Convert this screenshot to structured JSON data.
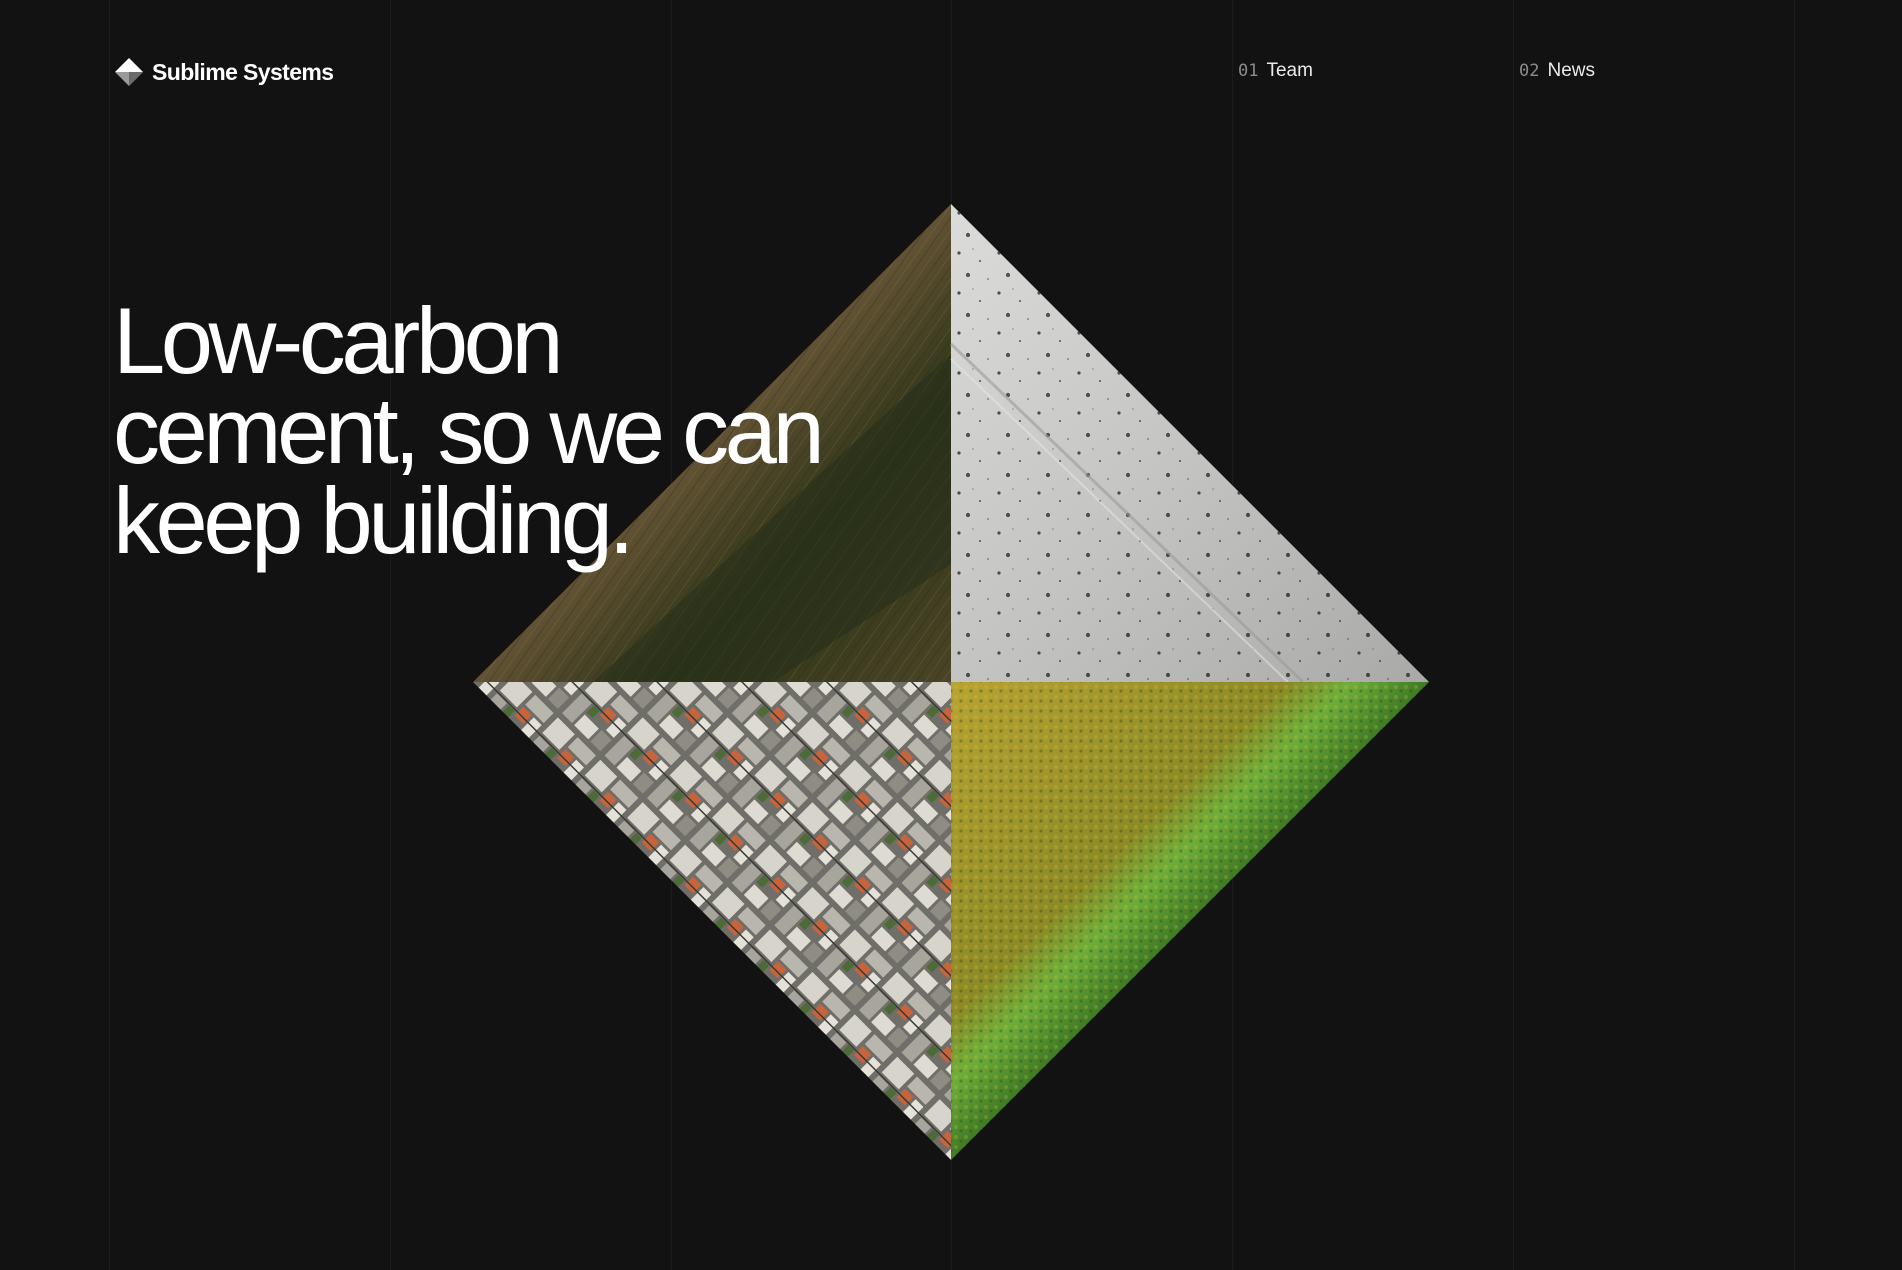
{
  "brand": {
    "name": "Sublime Systems",
    "logo_icon": "diamond-logo-icon"
  },
  "nav": {
    "items": [
      {
        "number": "01",
        "label": "Team"
      },
      {
        "number": "02",
        "label": "News"
      }
    ]
  },
  "hero": {
    "headline_lines": [
      "Low-carbon",
      "cement, so we can",
      "keep building."
    ]
  },
  "artwork": {
    "quadrants": [
      {
        "name": "dry-grass-quadrant",
        "palette": [
          "#6e5a3a",
          "#3d3a22",
          "#8a7350"
        ]
      },
      {
        "name": "concrete-quadrant",
        "palette": [
          "#cfcfcd",
          "#a6a6a4",
          "#2a2a2a"
        ]
      },
      {
        "name": "city-aerial-quadrant",
        "palette": [
          "#8b8a84",
          "#c9c6bd",
          "#c8643c"
        ]
      },
      {
        "name": "green-field-quadrant",
        "palette": [
          "#2e5d1e",
          "#9c8f2a",
          "#b8a432"
        ]
      }
    ]
  },
  "colors": {
    "background": "#121212",
    "text": "#ffffff",
    "muted": "#8c8c8c"
  }
}
